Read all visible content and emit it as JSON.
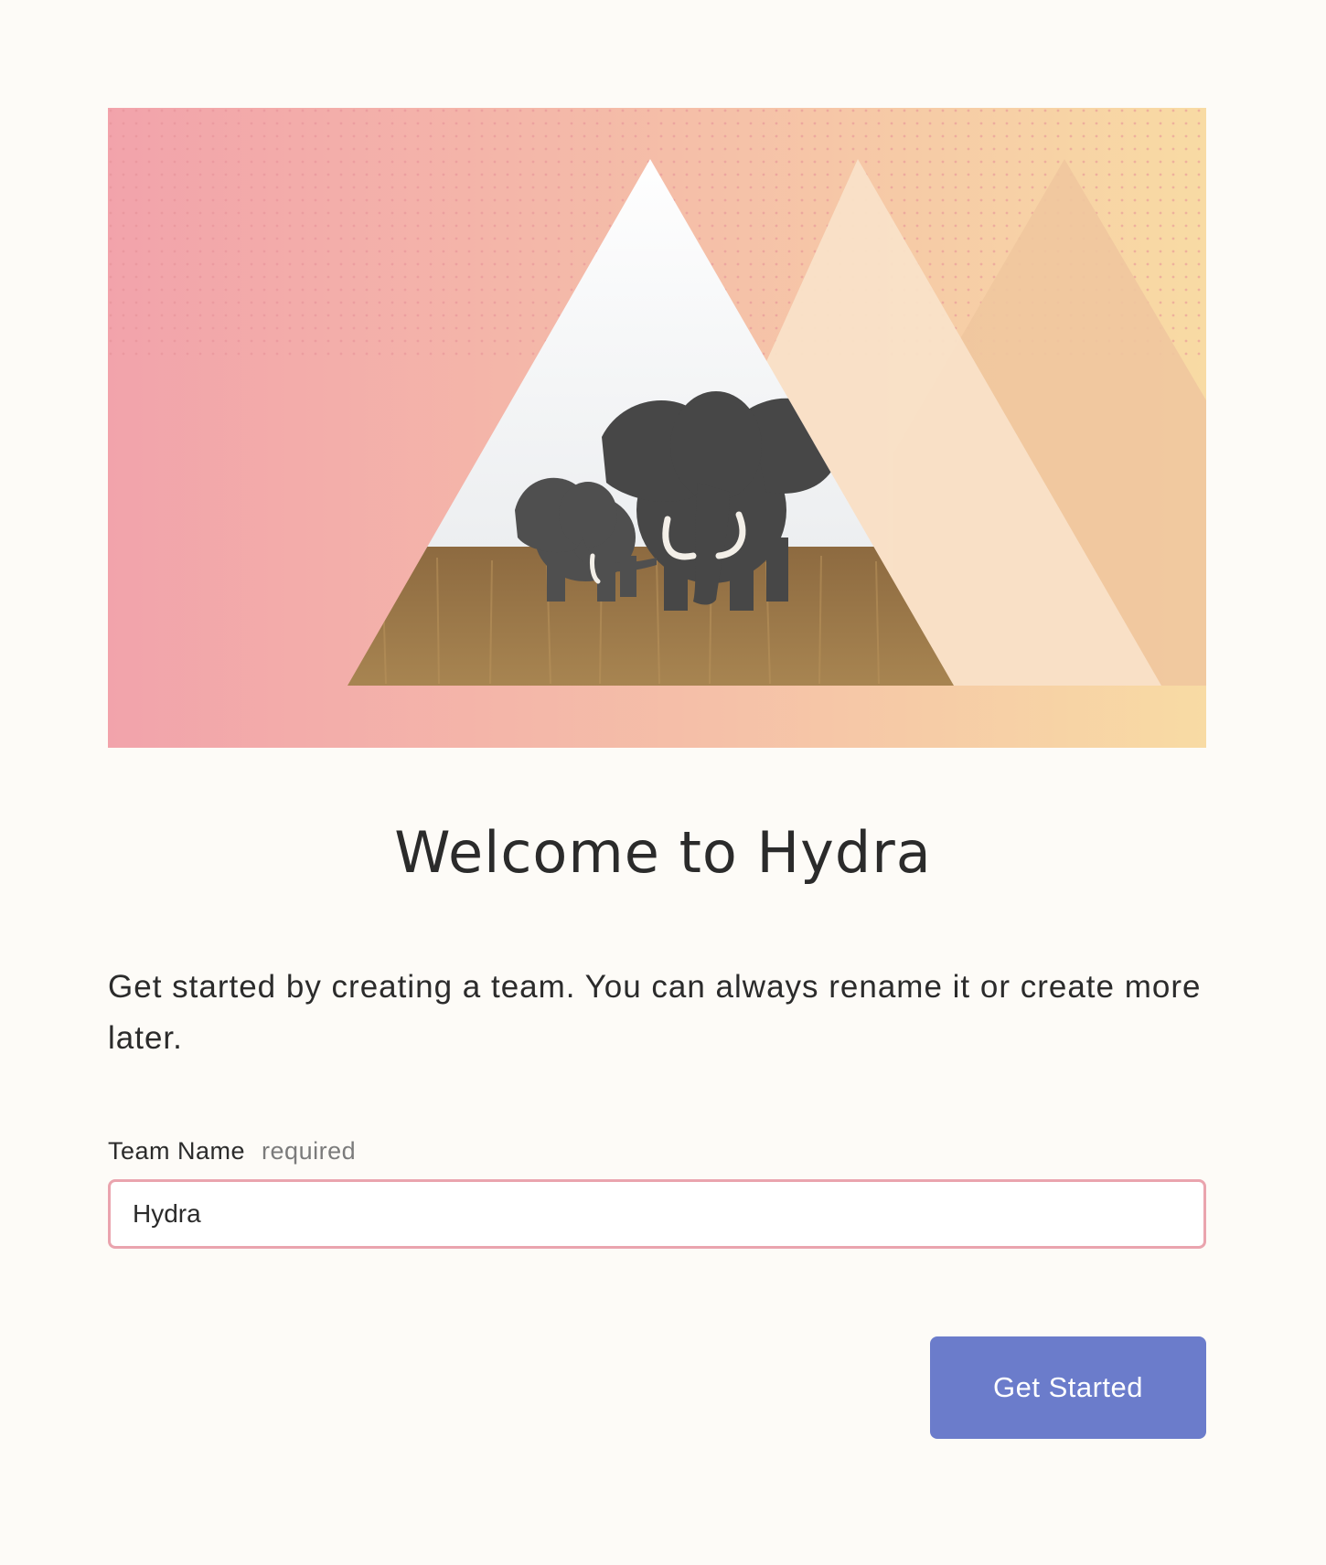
{
  "hero": {
    "illustration": "mountains-with-elephants-illustration",
    "colors": {
      "gradient_start": "#f2a3ab",
      "gradient_end": "#f8dba4",
      "mountain_mid": "#f9e1c8",
      "mountain_back": "#efc79f",
      "sky": "#ffffff",
      "grass": "#9c7748",
      "elephant": "#4a4a4a"
    }
  },
  "welcome": {
    "title": "Welcome to Hydra",
    "intro": "Get started by creating a team. You can always rename it or create more later."
  },
  "form": {
    "team_name_label": "Team Name",
    "required_label": "required",
    "team_name_value": "Hydra"
  },
  "actions": {
    "get_started_label": "Get Started"
  },
  "colors": {
    "page_background": "#fdfbf7",
    "input_border": "#eaa4ae",
    "button_background": "#6b7ccb",
    "button_text": "#ffffff"
  }
}
